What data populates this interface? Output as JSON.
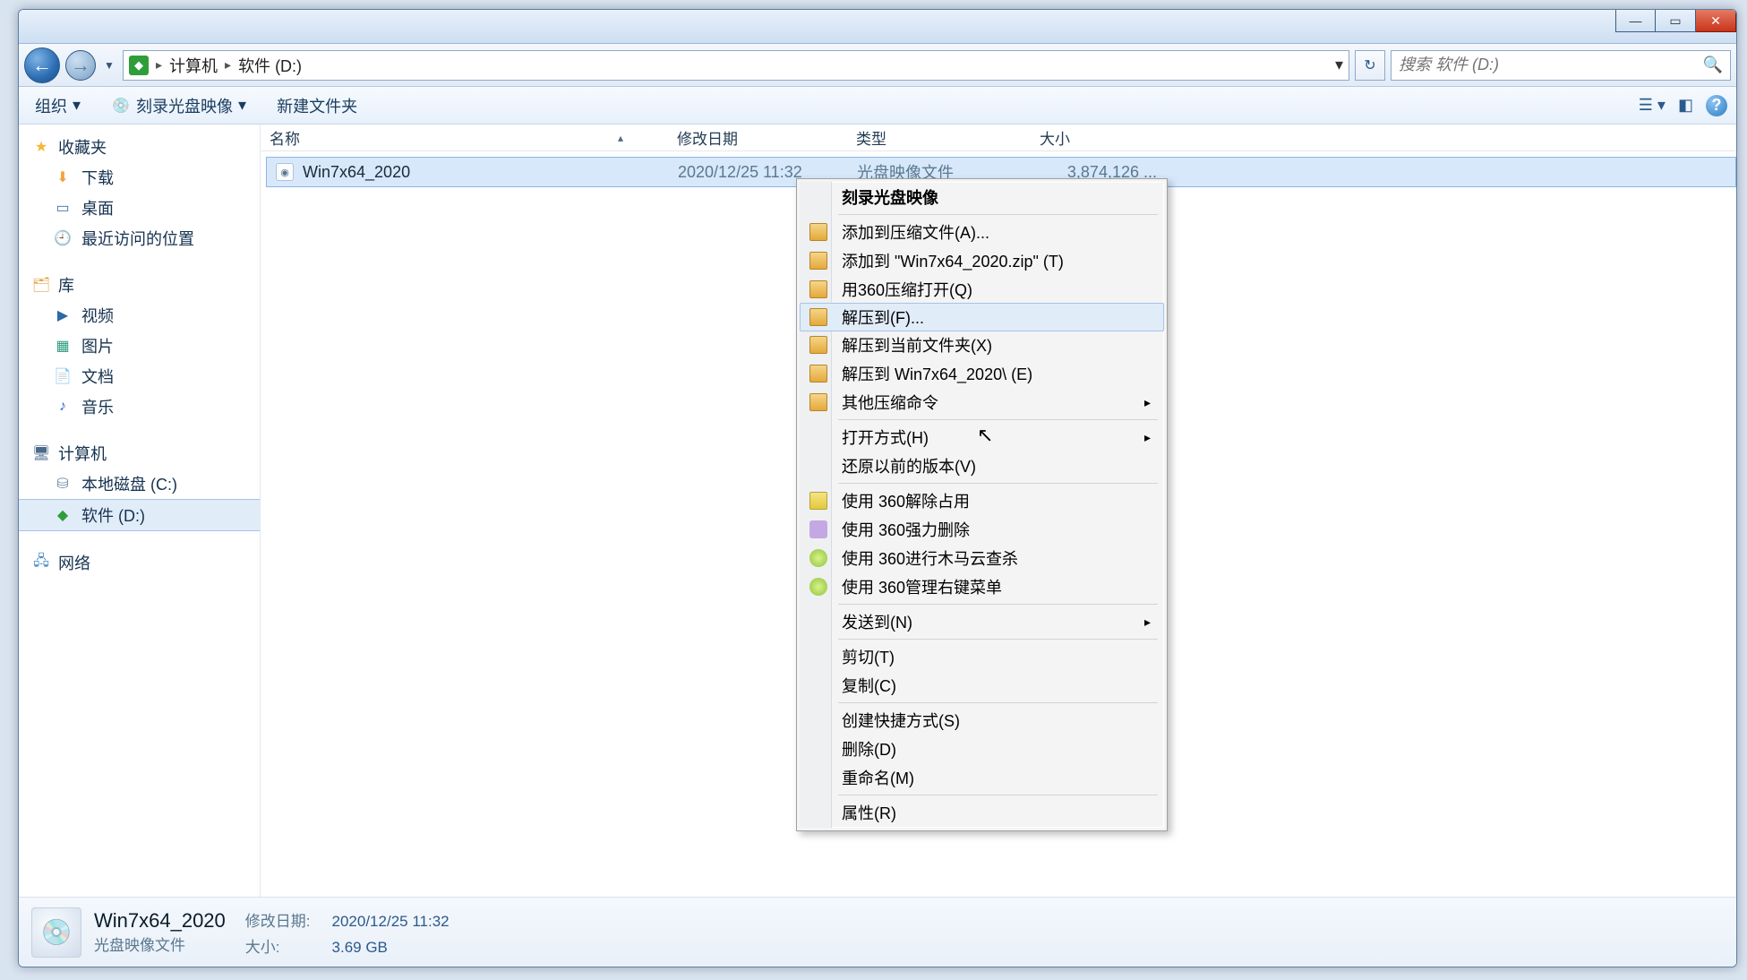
{
  "window_controls": {
    "min": "—",
    "max": "▭",
    "close": "✕"
  },
  "breadcrumb": {
    "root": "计算机",
    "current": "软件 (D:)"
  },
  "search": {
    "placeholder": "搜索 软件 (D:)"
  },
  "toolbar": {
    "organize": "组织",
    "burn": "刻录光盘映像",
    "new_folder": "新建文件夹"
  },
  "sidebar": {
    "favorites": {
      "header": "收藏夹",
      "items": [
        "下载",
        "桌面",
        "最近访问的位置"
      ]
    },
    "libraries": {
      "header": "库",
      "items": [
        "视频",
        "图片",
        "文档",
        "音乐"
      ]
    },
    "computer": {
      "header": "计算机",
      "items": [
        "本地磁盘 (C:)",
        "软件 (D:)"
      ]
    },
    "network": {
      "header": "网络"
    }
  },
  "columns": {
    "name": "名称",
    "date": "修改日期",
    "type": "类型",
    "size": "大小"
  },
  "files": [
    {
      "name": "Win7x64_2020",
      "date": "2020/12/25 11:32",
      "type": "光盘映像文件",
      "size": "3,874,126 ..."
    }
  ],
  "context_menu": {
    "burn_image": "刻录光盘映像",
    "add_archive": "添加到压缩文件(A)...",
    "add_zip": "添加到 \"Win7x64_2020.zip\" (T)",
    "open_360": "用360压缩打开(Q)",
    "extract_to": "解压到(F)...",
    "extract_here": "解压到当前文件夹(X)",
    "extract_folder": "解压到 Win7x64_2020\\ (E)",
    "other_compress": "其他压缩命令",
    "open_with": "打开方式(H)",
    "restore_prev": "还原以前的版本(V)",
    "unlock_360": "使用 360解除占用",
    "force_del_360": "使用 360强力删除",
    "scan_360": "使用 360进行木马云查杀",
    "menu_360": "使用 360管理右键菜单",
    "send_to": "发送到(N)",
    "cut": "剪切(T)",
    "copy": "复制(C)",
    "shortcut": "创建快捷方式(S)",
    "delete": "删除(D)",
    "rename": "重命名(M)",
    "properties": "属性(R)"
  },
  "details": {
    "title": "Win7x64_2020",
    "subtitle": "光盘映像文件",
    "date_label": "修改日期:",
    "date_value": "2020/12/25 11:32",
    "size_label": "大小:",
    "size_value": "3.69 GB"
  }
}
